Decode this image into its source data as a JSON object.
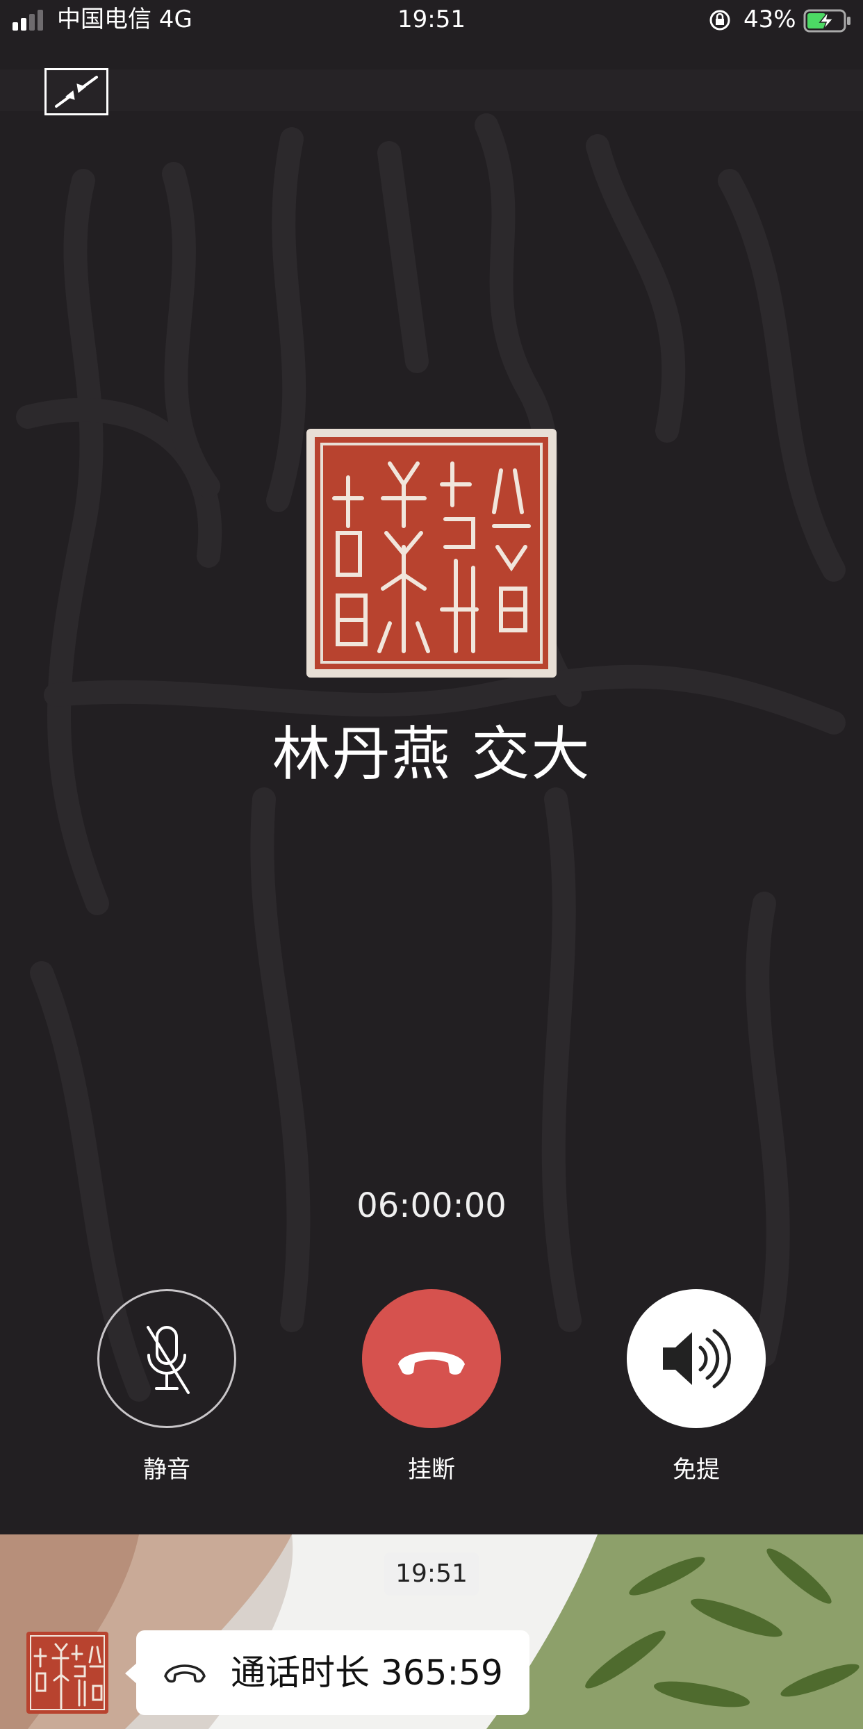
{
  "status_bar": {
    "carrier": "中国电信  4G",
    "time": "19:51",
    "battery_percent": "43%"
  },
  "call": {
    "contact_name": "林丹燕 交大",
    "timer": "06:00:00",
    "controls": {
      "mute_label": "静音",
      "hangup_label": "挂断",
      "speaker_label": "免提"
    }
  },
  "chat_preview": {
    "timestamp": "19:51",
    "message": "通话时长 365:59"
  },
  "colors": {
    "background": "#221f22",
    "hangup": "#d6524e",
    "seal_red": "#b8432f"
  },
  "icons": [
    "minimize-icon",
    "avatar-seal",
    "mic-off-icon",
    "phone-hangup-icon",
    "speaker-icon",
    "lock-rotation-icon",
    "battery-charging-icon",
    "signal-icon"
  ]
}
